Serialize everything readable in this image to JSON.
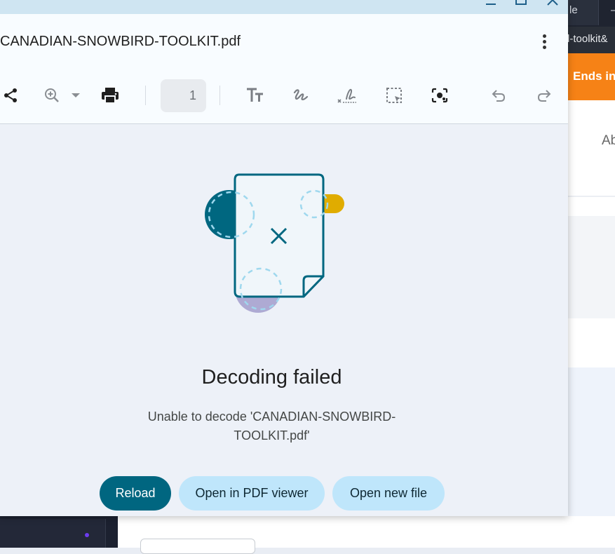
{
  "window": {
    "filename": "CANADIAN-SNOWBIRD-TOOLKIT.pdf",
    "current_page": "1"
  },
  "error": {
    "title": "Decoding failed",
    "message": "Unable to decode 'CANADIAN-SNOWBIRD-TOOLKIT.pdf'",
    "message_line1": "Unable to decode 'CANADIAN-SNOWBIRD-",
    "message_line2": "TOOLKIT.pdf'"
  },
  "buttons": {
    "reload": "Reload",
    "open_in_pdf_viewer": "Open in PDF viewer",
    "open_new_file": "Open new file"
  },
  "background": {
    "tab1_text": "le",
    "tab2_text": "–",
    "url_text": "d-toolkit&",
    "banner_text": "Ends in",
    "card_text": "Ab"
  },
  "toolbar_icons": [
    "share-icon",
    "zoom-in-icon",
    "dropdown-arrow-icon",
    "print-icon",
    "text-size-icon",
    "draw-icon",
    "signature-icon",
    "select-region-icon",
    "camera-search-icon",
    "undo-icon",
    "redo-icon"
  ],
  "colors": {
    "primary": "#006680",
    "tonal": "#bfe6fb",
    "accent_orange": "#f68216",
    "illustration_teal": "#006780",
    "illustration_yellow": "#e0ac00",
    "illustration_purple": "#aeaad3"
  }
}
